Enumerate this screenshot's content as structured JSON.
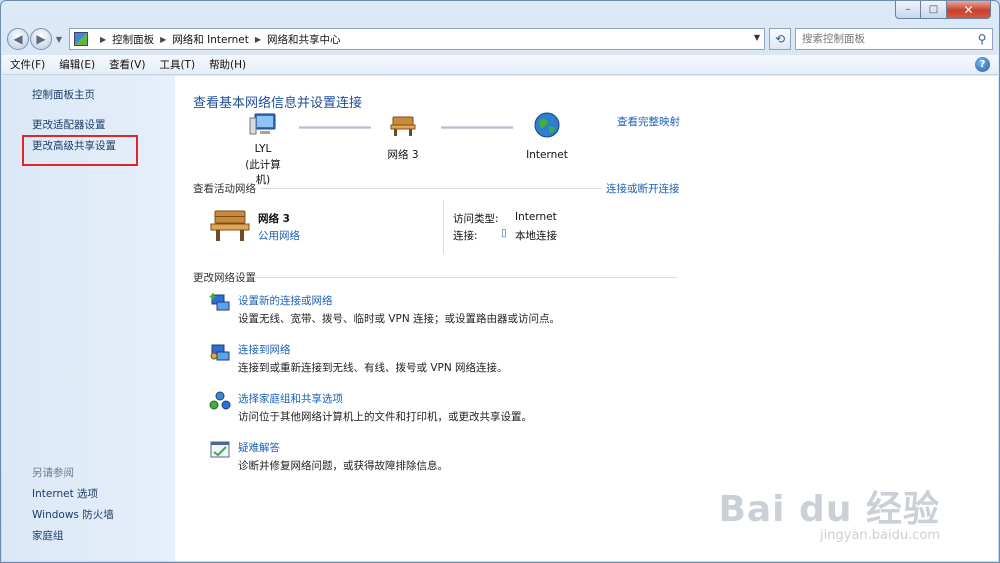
{
  "window": {
    "caption_min": "–",
    "caption_max": "□",
    "caption_close": "✕"
  },
  "address": {
    "crumbs": [
      "控制面板",
      "网络和 Internet",
      "网络和共享中心"
    ],
    "search_placeholder": "搜索控制面板"
  },
  "menu": [
    "文件(F)",
    "编辑(E)",
    "查看(V)",
    "工具(T)",
    "帮助(H)"
  ],
  "help_glyph": "?",
  "sidebar": {
    "links": [
      "控制面板主页",
      "更改适配器设置",
      "更改高级共享设置"
    ],
    "see_also_title": "另请参阅",
    "see_also": [
      "Internet 选项",
      "Windows 防火墙",
      "家庭组"
    ]
  },
  "main": {
    "title": "查看基本网络信息并设置连接",
    "full_map": "查看完整映射",
    "map": {
      "computer_name": "LYL",
      "computer_sub": "(此计算机)",
      "network": "网络  3",
      "internet": "Internet"
    },
    "active_networks": {
      "heading": "查看活动网络",
      "connect_link": "连接或断开连接",
      "network_name": "网络  3",
      "network_type": "公用网络",
      "access_type_label": "访问类型:",
      "access_type_value": "Internet",
      "connections_label": "连接:",
      "connections_value": "本地连接"
    },
    "change_settings": {
      "heading": "更改网络设置",
      "tasks": [
        {
          "title": "设置新的连接或网络",
          "desc": "设置无线、宽带、拨号、临时或 VPN 连接；或设置路由器或访问点。",
          "icon": "new-connection-icon"
        },
        {
          "title": "连接到网络",
          "desc": "连接到或重新连接到无线、有线、拨号或 VPN 网络连接。",
          "icon": "connect-network-icon"
        },
        {
          "title": "选择家庭组和共享选项",
          "desc": "访问位于其他网络计算机上的文件和打印机，或更改共享设置。",
          "icon": "homegroup-icon"
        },
        {
          "title": "疑难解答",
          "desc": "诊断并修复网络问题，或获得故障排除信息。",
          "icon": "troubleshoot-icon"
        }
      ]
    }
  },
  "watermark": {
    "main": "Bai du 经验",
    "sub": "jingyan.baidu.com"
  },
  "colors": {
    "link": "#1c61b8",
    "title": "#1f4f98",
    "highlight": "#e0262a"
  }
}
